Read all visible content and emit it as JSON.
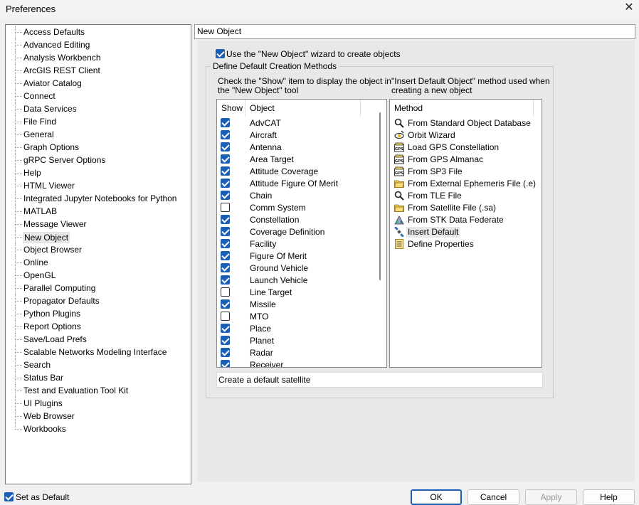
{
  "window": {
    "title": "Preferences",
    "close_glyph": "✕"
  },
  "tree": {
    "items": [
      "Access Defaults",
      "Advanced Editing",
      "Analysis Workbench",
      "ArcGIS REST Client",
      "Aviator Catalog",
      "Connect",
      "Data Services",
      "File Find",
      "General",
      "Graph Options",
      "gRPC Server Options",
      "Help",
      "HTML Viewer",
      "Integrated Jupyter Notebooks for Python",
      "MATLAB",
      "Message Viewer",
      "New Object",
      "Object Browser",
      "Online",
      "OpenGL",
      "Parallel Computing",
      "Propagator Defaults",
      "Python Plugins",
      "Report Options",
      "Save/Load Prefs",
      "Scalable Networks Modeling Interface",
      "Search",
      "Status Bar",
      "Test and Evaluation Tool Kit",
      "UI Plugins",
      "Web Browser",
      "Workbooks"
    ],
    "selected": "New Object"
  },
  "panel": {
    "header": "New Object",
    "wizard_label": "Use the \"New Object\" wizard to create objects",
    "wizard_checked": true,
    "group_title": "Define Default Creation Methods",
    "left_desc_line1": "Check the \"Show\" item to display the object in",
    "left_desc_line2": "the \"New Object\" tool",
    "right_desc_line1": "\"Insert Default Object\" method used when",
    "right_desc_line2": "creating a new object",
    "objects_columns": {
      "show": "Show",
      "object": "Object"
    },
    "objects": [
      {
        "name": "AdvCAT",
        "checked": true
      },
      {
        "name": "Aircraft",
        "checked": true
      },
      {
        "name": "Antenna",
        "checked": true
      },
      {
        "name": "Area Target",
        "checked": true
      },
      {
        "name": "Attitude Coverage",
        "checked": true
      },
      {
        "name": "Attitude Figure Of Merit",
        "checked": true
      },
      {
        "name": "Chain",
        "checked": true
      },
      {
        "name": "Comm System",
        "checked": false
      },
      {
        "name": "Constellation",
        "checked": true
      },
      {
        "name": "Coverage Definition",
        "checked": true
      },
      {
        "name": "Facility",
        "checked": true
      },
      {
        "name": "Figure Of Merit",
        "checked": true
      },
      {
        "name": "Ground Vehicle",
        "checked": true
      },
      {
        "name": "Launch Vehicle",
        "checked": true
      },
      {
        "name": "Line Target",
        "checked": false
      },
      {
        "name": "Missile",
        "checked": true
      },
      {
        "name": "MTO",
        "checked": false
      },
      {
        "name": "Place",
        "checked": true
      },
      {
        "name": "Planet",
        "checked": true
      },
      {
        "name": "Radar",
        "checked": true
      },
      {
        "name": "Receiver",
        "checked": true
      }
    ],
    "methods_column": "Method",
    "methods": [
      {
        "label": "From Standard Object Database",
        "icon": "magnifier-icon"
      },
      {
        "label": "Orbit Wizard",
        "icon": "orbit-wizard-icon"
      },
      {
        "label": "Load GPS Constellation",
        "icon": "gps-icon"
      },
      {
        "label": "From GPS Almanac",
        "icon": "gps-icon"
      },
      {
        "label": "From SP3 File",
        "icon": "gps-icon"
      },
      {
        "label": "From External Ephemeris File (.e)",
        "icon": "folder-icon"
      },
      {
        "label": "From TLE File",
        "icon": "magnifier-icon"
      },
      {
        "label": "From Satellite File (.sa)",
        "icon": "folder-icon"
      },
      {
        "label": "From STK Data Federate",
        "icon": "federate-icon"
      },
      {
        "label": "Insert Default",
        "icon": "satellite-icon"
      },
      {
        "label": "Define Properties",
        "icon": "properties-icon"
      }
    ],
    "selected_method": "Insert Default",
    "status_text": "Create a default satellite"
  },
  "footer": {
    "set_default_label": "Set as Default",
    "set_default_checked": true,
    "ok": "OK",
    "cancel": "Cancel",
    "apply": "Apply",
    "help": "Help"
  }
}
